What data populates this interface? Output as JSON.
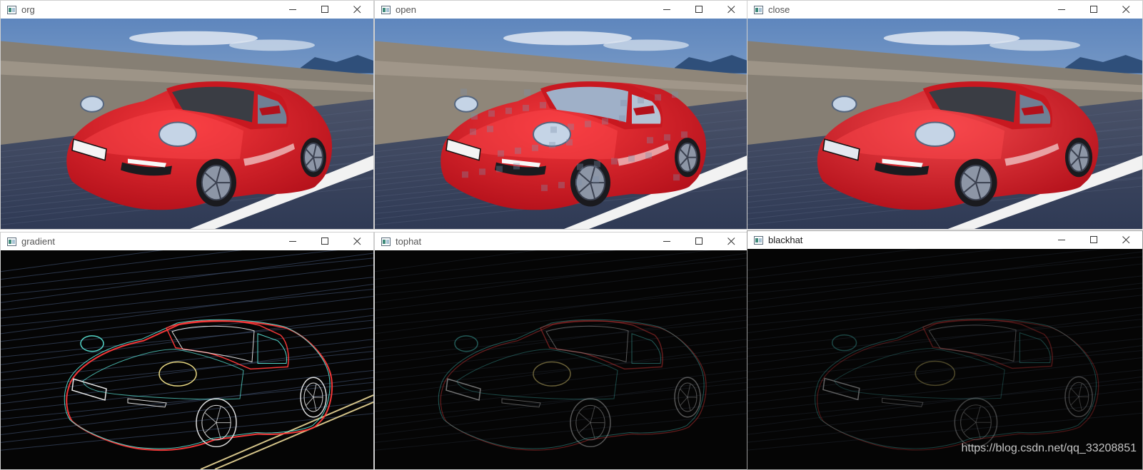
{
  "windows": [
    {
      "title": "org",
      "kind": "photo",
      "style": "normal",
      "active": false
    },
    {
      "title": "open",
      "kind": "photo",
      "style": "blocky",
      "active": false
    },
    {
      "title": "close",
      "kind": "photo",
      "style": "smooth",
      "active": false
    },
    {
      "title": "gradient",
      "kind": "edges",
      "style": "bright",
      "active": false
    },
    {
      "title": "tophat",
      "kind": "edges",
      "style": "dim",
      "active": false
    },
    {
      "title": "blackhat",
      "kind": "edges",
      "style": "faint",
      "active": true
    }
  ],
  "icons": {
    "app": "opencv-window-icon",
    "minimize": "minimize-icon",
    "maximize": "maximize-icon",
    "close": "close-icon"
  },
  "colors": {
    "car_red": "#e21a1f",
    "sky": "#6f95c4",
    "road": "#3a4560",
    "edge_black": "#050505"
  },
  "watermark": "https://blog.csdn.net/qq_33208851"
}
